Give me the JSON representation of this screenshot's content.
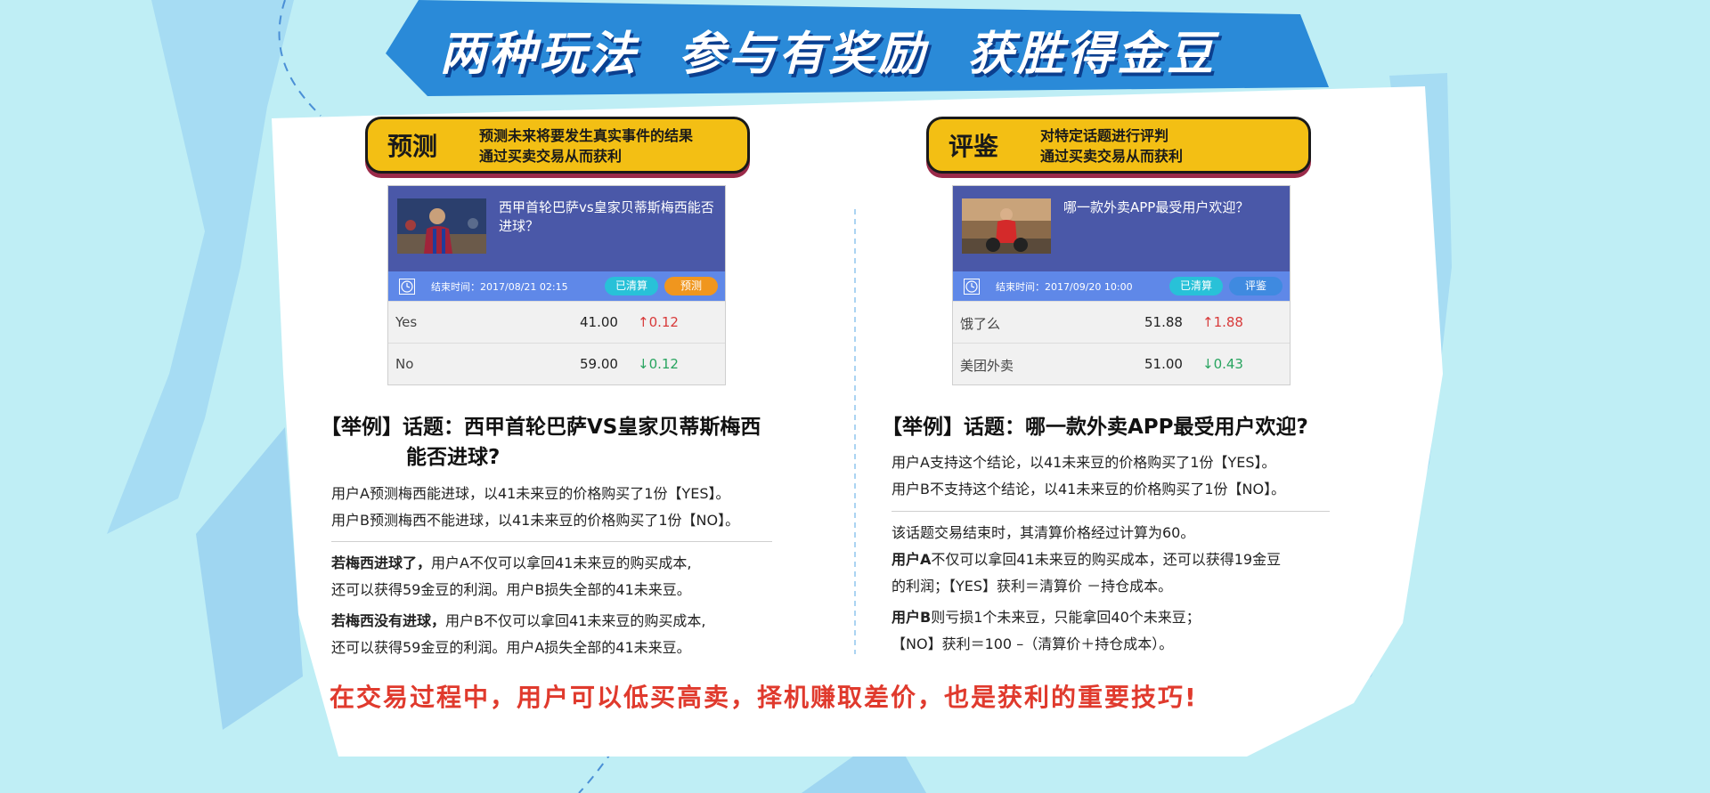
{
  "banner": {
    "title": "两种玩法  参与有奖励  获胜得金豆"
  },
  "left": {
    "pill": {
      "title": "预测",
      "desc_line1": "预测未来将要发生真实事件的结果",
      "desc_line2": "通过买卖交易从而获利"
    },
    "card": {
      "question": "西甲首轮巴萨vs皇家贝蒂斯梅西能否进球？",
      "end_time": "结束时间：2017/08/21 02:15",
      "badge1": "已清算",
      "badge2": "预测",
      "rows": [
        {
          "label": "Yes",
          "price": "41.00",
          "arrow": "↑",
          "change": "0.12"
        },
        {
          "label": "No",
          "price": "59.00",
          "arrow": "↓",
          "change": "0.12"
        }
      ]
    },
    "example": {
      "head_line1": "【举例】话题：西甲首轮巴萨VS皇家贝蒂斯梅西",
      "head_line2": "能否进球?",
      "l1": "用户A预测梅西能进球，以41未来豆的价格购买了1份【YES】。",
      "l2": "用户B预测梅西不能进球，以41未来豆的价格购买了1份【NO】。",
      "l3_bold": "若梅西进球了，",
      "l3": "用户A不仅可以拿回41未来豆的购买成本,",
      "l4": "还可以获得59金豆的利润。用户B损失全部的41未来豆。",
      "l5_bold": "若梅西没有进球，",
      "l5": "用户B不仅可以拿回41未来豆的购买成本,",
      "l6": "还可以获得59金豆的利润。用户A损失全部的41未来豆。"
    }
  },
  "right": {
    "pill": {
      "title": "评鉴",
      "desc_line1": "对特定话题进行评判",
      "desc_line2": "通过买卖交易从而获利"
    },
    "card": {
      "question": "哪一款外卖APP最受用户欢迎？",
      "end_time": "结束时间：2017/09/20 10:00",
      "badge1": "已清算",
      "badge2": "评鉴",
      "rows": [
        {
          "label": "饿了么",
          "price": "51.88",
          "arrow": "↑",
          "change": "1.88"
        },
        {
          "label": "美团外卖",
          "price": "51.00",
          "arrow": "↓",
          "change": "0.43"
        }
      ]
    },
    "example": {
      "head": "【举例】话题：哪一款外卖APP最受用户欢迎?",
      "l1": "用户A支持这个结论，以41未来豆的价格购买了1份【YES】。",
      "l2": "用户B不支持这个结论，以41未来豆的价格购买了1份【NO】。",
      "l3": "该话题交易结束时，其清算价格经过计算为60。",
      "l4_bold": "用户A",
      "l4": "不仅可以拿回41未来豆的购买成本，还可以获得19金豆",
      "l5": "的利润；【YES】获利＝清算价 －持仓成本。",
      "l6_bold": "用户B",
      "l6": "则亏损1个未来豆，只能拿回40个未来豆；",
      "l7": "【NO】获利＝100 –（清算价＋持仓成本）。"
    }
  },
  "footer": {
    "text": "在交易过程中，用户可以低买高卖，择机赚取差价，也是获利的重要技巧!"
  },
  "colors": {
    "banner": "#2a8ad8",
    "pill": "#f3bf14",
    "card_head": "#4a58a8",
    "card_bar": "#5f88e8",
    "up": "#d83a3a",
    "down": "#28a45f",
    "footer": "#e03a2d"
  }
}
